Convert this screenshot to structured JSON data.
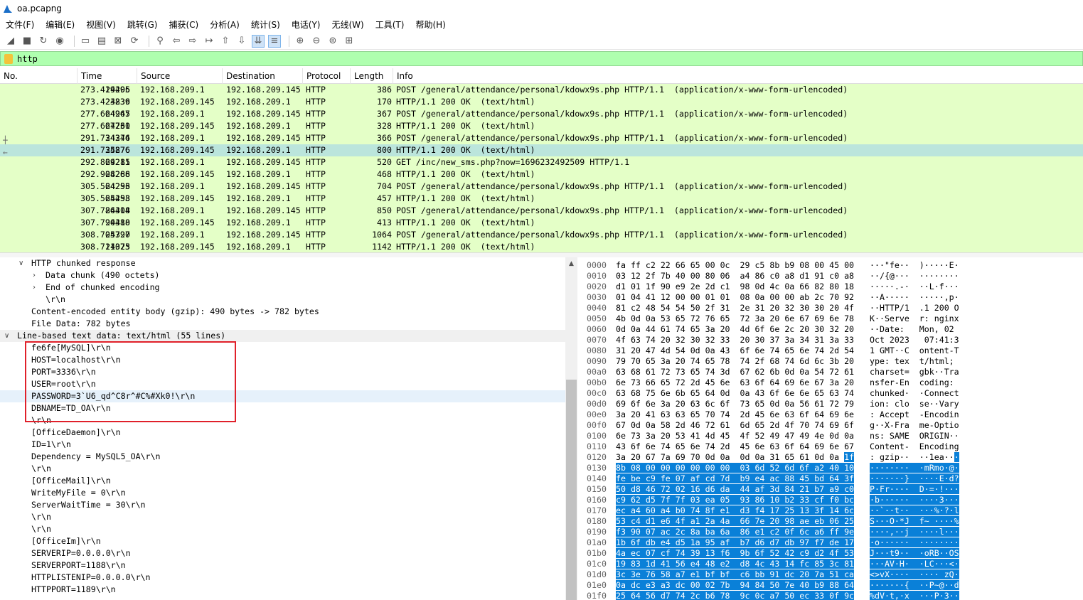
{
  "title": "oa.pcapng",
  "menu": [
    "文件(F)",
    "编辑(E)",
    "视图(V)",
    "跳转(G)",
    "捕获(C)",
    "分析(A)",
    "统计(S)",
    "电话(Y)",
    "无线(W)",
    "工具(T)",
    "帮助(H)"
  ],
  "filter": {
    "value": "http"
  },
  "columns": [
    "No.",
    "Time",
    "Source",
    "Destination",
    "Protocol",
    "Length",
    "Info"
  ],
  "packets": [
    {
      "no": "24206",
      "time": "273.419495",
      "src": "192.168.209.1",
      "dst": "192.168.209.145",
      "proto": "HTTP",
      "len": "386",
      "info": "POST /general/attendance/personal/kdowx9s.php HTTP/1.1  (application/x-www-form-urlencoded)"
    },
    {
      "no": "24236",
      "time": "273.423839",
      "src": "192.168.209.145",
      "dst": "192.168.209.1",
      "proto": "HTTP",
      "len": "170",
      "info": "HTTP/1.1 200 OK  (text/html)"
    },
    {
      "no": "24245",
      "time": "277.664967",
      "src": "192.168.209.1",
      "dst": "192.168.209.145",
      "proto": "HTTP",
      "len": "367",
      "info": "POST /general/attendance/personal/kdowx9s.php HTTP/1.1  (application/x-www-form-urlencoded)"
    },
    {
      "no": "24260",
      "time": "277.667731",
      "src": "192.168.209.145",
      "dst": "192.168.209.1",
      "proto": "HTTP",
      "len": "328",
      "info": "HTTP/1.1 200 OK  (text/html)"
    },
    {
      "no": "24274",
      "time": "291.734346",
      "src": "192.168.209.1",
      "dst": "192.168.209.145",
      "proto": "HTTP",
      "len": "366",
      "info": "POST /general/attendance/personal/kdowx9s.php HTTP/1.1  (application/x-www-form-urlencoded)"
    },
    {
      "no": "24276",
      "time": "291.735876",
      "src": "192.168.209.145",
      "dst": "192.168.209.1",
      "proto": "HTTP",
      "len": "800",
      "info": "HTTP/1.1 200 OK  (text/html)"
    },
    {
      "no": "24285",
      "time": "292.869211",
      "src": "192.168.209.1",
      "dst": "192.168.209.145",
      "proto": "HTTP",
      "len": "520",
      "info": "GET /inc/new_sms.php?now=1696232492509 HTTP/1.1"
    },
    {
      "no": "24286",
      "time": "292.908268",
      "src": "192.168.209.145",
      "dst": "192.168.209.1",
      "proto": "HTTP",
      "len": "468",
      "info": "HTTP/1.1 200 OK  (text/html)"
    },
    {
      "no": "24296",
      "time": "305.564253",
      "src": "192.168.209.1",
      "dst": "192.168.209.145",
      "proto": "HTTP",
      "len": "704",
      "info": "POST /general/attendance/personal/kdowx9s.php HTTP/1.1  (application/x-www-form-urlencoded)"
    },
    {
      "no": "24298",
      "time": "305.565453",
      "src": "192.168.209.145",
      "dst": "192.168.209.1",
      "proto": "HTTP",
      "len": "457",
      "info": "HTTP/1.1 200 OK  (text/html)"
    },
    {
      "no": "24308",
      "time": "307.786414",
      "src": "192.168.209.1",
      "dst": "192.168.209.145",
      "proto": "HTTP",
      "len": "850",
      "info": "POST /general/attendance/personal/kdowx9s.php HTTP/1.1  (application/x-www-form-urlencoded)"
    },
    {
      "no": "24310",
      "time": "307.790488",
      "src": "192.168.209.145",
      "dst": "192.168.209.1",
      "proto": "HTTP",
      "len": "413",
      "info": "HTTP/1.1 200 OK  (text/html)"
    },
    {
      "no": "24320",
      "time": "308.705797",
      "src": "192.168.209.1",
      "dst": "192.168.209.145",
      "proto": "HTTP",
      "len": "1064",
      "info": "POST /general/attendance/personal/kdowx9s.php HTTP/1.1  (application/x-www-form-urlencoded)"
    },
    {
      "no": "24323",
      "time": "308.711075",
      "src": "192.168.209.145",
      "dst": "192.168.209.1",
      "proto": "HTTP",
      "len": "1142",
      "info": "HTTP/1.1 200 OK  (text/html)"
    }
  ],
  "selected_packet": "24276",
  "details": [
    {
      "text": "HTTP chunked response",
      "toggle": "open"
    },
    {
      "text": "Data chunk (490 octets)",
      "toggle": "closed"
    },
    {
      "text": "End of chunked encoding",
      "toggle": "closed"
    },
    {
      "text": "\\r\\n",
      "toggle": ""
    },
    {
      "text": "Content-encoded entity body (gzip): 490 bytes -> 782 bytes",
      "toggle": ""
    },
    {
      "text": "File Data: 782 bytes",
      "toggle": ""
    },
    {
      "text": "Line-based text data: text/html (55 lines)",
      "toggle": "open"
    },
    {
      "text": "fe6fe[MySQL]\\r\\n",
      "toggle": ""
    },
    {
      "text": "HOST=localhost\\r\\n",
      "toggle": ""
    },
    {
      "text": "PORT=3336\\r\\n",
      "toggle": ""
    },
    {
      "text": "USER=root\\r\\n",
      "toggle": ""
    },
    {
      "text": "PASSWORD=3`U6_qd^C8r^#C%#Xk0!\\r\\n",
      "toggle": ""
    },
    {
      "text": "DBNAME=TD_OA\\r\\n",
      "toggle": ""
    },
    {
      "text": "\\r\\n",
      "toggle": ""
    },
    {
      "text": "[OfficeDaemon]\\r\\n",
      "toggle": ""
    },
    {
      "text": "ID=1\\r\\n",
      "toggle": ""
    },
    {
      "text": "Dependency = MySQL5_OA\\r\\n",
      "toggle": ""
    },
    {
      "text": "\\r\\n",
      "toggle": ""
    },
    {
      "text": "[OfficeMail]\\r\\n",
      "toggle": ""
    },
    {
      "text": "WriteMyFile = 0\\r\\n",
      "toggle": ""
    },
    {
      "text": "ServerWaitTime = 30\\r\\n",
      "toggle": ""
    },
    {
      "text": "\\r\\n",
      "toggle": ""
    },
    {
      "text": "\\r\\n",
      "toggle": ""
    },
    {
      "text": "[OfficeIm]\\r\\n",
      "toggle": ""
    },
    {
      "text": "SERVERIP=0.0.0.0\\r\\n",
      "toggle": ""
    },
    {
      "text": "SERVERPORT=1188\\r\\n",
      "toggle": ""
    },
    {
      "text": "HTTPLISTENIP=0.0.0.0\\r\\n",
      "toggle": ""
    },
    {
      "text": "HTTPPORT=1189\\r\\n",
      "toggle": ""
    }
  ],
  "hex": [
    {
      "off": "0000",
      "bytes": "fa ff c2 22 66 65 00 0c  29 c5 8b b9 08 00 45 00",
      "ascii": "···\"fe··  )·····E·"
    },
    {
      "off": "0010",
      "bytes": "03 12 2f 7b 40 00 80 06  a4 86 c0 a8 d1 91 c0 a8",
      "ascii": "··/{@···  ········"
    },
    {
      "off": "0020",
      "bytes": "d1 01 1f 90 e9 2e 2d c1  98 0d 4c 0a 66 82 80 18",
      "ascii": "·····.-·  ··L·f···"
    },
    {
      "off": "0030",
      "bytes": "01 04 41 12 00 00 01 01  08 0a 00 00 ab 2c 70 92",
      "ascii": "··A·····  ·····,p·"
    },
    {
      "off": "0040",
      "bytes": "81 c2 48 54 54 50 2f 31  2e 31 20 32 30 30 20 4f",
      "ascii": "··HTTP/1  .1 200 O"
    },
    {
      "off": "0050",
      "bytes": "4b 0d 0a 53 65 72 76 65  72 3a 20 6e 67 69 6e 78",
      "ascii": "K··Serve  r: nginx"
    },
    {
      "off": "0060",
      "bytes": "0d 0a 44 61 74 65 3a 20  4d 6f 6e 2c 20 30 32 20",
      "ascii": "··Date:   Mon, 02 "
    },
    {
      "off": "0070",
      "bytes": "4f 63 74 20 32 30 32 33  20 30 37 3a 34 31 3a 33",
      "ascii": "Oct 2023   07:41:3"
    },
    {
      "off": "0080",
      "bytes": "31 20 47 4d 54 0d 0a 43  6f 6e 74 65 6e 74 2d 54",
      "ascii": "1 GMT··C  ontent-T"
    },
    {
      "off": "0090",
      "bytes": "79 70 65 3a 20 74 65 78  74 2f 68 74 6d 6c 3b 20",
      "ascii": "ype: tex  t/html; "
    },
    {
      "off": "00a0",
      "bytes": "63 68 61 72 73 65 74 3d  67 62 6b 0d 0a 54 72 61",
      "ascii": "charset=  gbk··Tra"
    },
    {
      "off": "00b0",
      "bytes": "6e 73 66 65 72 2d 45 6e  63 6f 64 69 6e 67 3a 20",
      "ascii": "nsfer-En  coding: "
    },
    {
      "off": "00c0",
      "bytes": "63 68 75 6e 6b 65 64 0d  0a 43 6f 6e 6e 65 63 74",
      "ascii": "chunked·  ·Connect"
    },
    {
      "off": "00d0",
      "bytes": "69 6f 6e 3a 20 63 6c 6f  73 65 0d 0a 56 61 72 79",
      "ascii": "ion: clo  se··Vary"
    },
    {
      "off": "00e0",
      "bytes": "3a 20 41 63 63 65 70 74  2d 45 6e 63 6f 64 69 6e",
      "ascii": ": Accept  -Encodin"
    },
    {
      "off": "00f0",
      "bytes": "67 0d 0a 58 2d 46 72 61  6d 65 2d 4f 70 74 69 6f",
      "ascii": "g··X-Fra  me-Optio"
    },
    {
      "off": "0100",
      "bytes": "6e 73 3a 20 53 41 4d 45  4f 52 49 47 49 4e 0d 0a",
      "ascii": "ns: SAME  ORIGIN··"
    },
    {
      "off": "0110",
      "bytes": "43 6f 6e 74 65 6e 74 2d  45 6e 63 6f 64 69 6e 67",
      "ascii": "Content-  Encoding"
    },
    {
      "off": "0120",
      "bytes": "3a 20 67 7a 69 70 0d 0a  0d 0a 31 65 61 0d 0a",
      "sel": "1f",
      "ascii": ": gzip··  ··1ea··",
      "asel": "·"
    },
    {
      "off": "0130",
      "bytes": "",
      "sel": "8b 08 00 00 00 00 00 00  03 6d 52 6d 6f a2 40 10",
      "ascii": "",
      "asel": "········  ·mRmo·@·"
    },
    {
      "off": "0140",
      "bytes": "",
      "sel": "fe be c9 fe 07 af cd 7d  b9 e4 ac 88 45 bd 64 3f",
      "ascii": "",
      "asel": "·······}  ····E·d?"
    },
    {
      "off": "0150",
      "bytes": "",
      "sel": "50 d8 46 72 02 16 d6 da  44 af 3d 84 21 b7 a9 c0",
      "ascii": "",
      "asel": "P·Fr····  D·=·!···"
    },
    {
      "off": "0160",
      "bytes": "",
      "sel": "c9 62 d5 7f 7f 03 ea 05  93 86 10 b2 33 cf f0 bc",
      "ascii": "",
      "asel": "·b······  ····3···"
    },
    {
      "off": "0170",
      "bytes": "",
      "sel": "ec a4 60 a4 b0 74 8f e1  d3 f4 17 25 13 3f 14 6c",
      "ascii": "",
      "asel": "··`··t··  ···%·?·l"
    },
    {
      "off": "0180",
      "bytes": "",
      "sel": "53 c4 d1 e6 4f a1 2a 4a  66 7e 20 98 ae eb 06 25",
      "ascii": "",
      "asel": "S···O·*J  f~ ····%"
    },
    {
      "off": "0190",
      "bytes": "",
      "sel": "f3 90 07 ac 2c 8a ba 6a  86 e1 c2 0f 6c a6 ff 9e",
      "ascii": "",
      "asel": "····,··j  ····l···"
    },
    {
      "off": "01a0",
      "bytes": "",
      "sel": "1b 6f db e4 d5 1a 95 af  b7 d6 d7 db 97 f7 de 17",
      "ascii": "",
      "asel": "·o······  ········"
    },
    {
      "off": "01b0",
      "bytes": "",
      "sel": "4a ec 07 cf 74 39 13 f6  9b 6f 52 42 c9 d2 4f 53",
      "ascii": "",
      "asel": "J···t9··  ·oRB··OS"
    },
    {
      "off": "01c0",
      "bytes": "",
      "sel": "19 83 1d 41 56 e4 48 e2  d8 4c 43 14 fc 85 3c 81",
      "ascii": "",
      "asel": "···AV·H·  ·LC···<·"
    },
    {
      "off": "01d0",
      "bytes": "",
      "sel": "3c 3e 76 58 a7 e1 bf bf  c6 bb 91 dc 20 7a 51 ca",
      "ascii": "",
      "asel": "<>vX····  ···· zQ·"
    },
    {
      "off": "01e0",
      "bytes": "",
      "sel": "0a dc e3 a3 dc 00 02 7b  94 84 50 7e 40 b9 88 64",
      "ascii": "",
      "asel": "·······{  ··P~@··d"
    },
    {
      "off": "01f0",
      "bytes": "",
      "sel": "25 64 56 d7 74 2c b6 78  9c 0c a7 50 ec 33 0f 9c",
      "ascii": "",
      "asel": "%dV·t,·x  ···P·3··"
    }
  ]
}
